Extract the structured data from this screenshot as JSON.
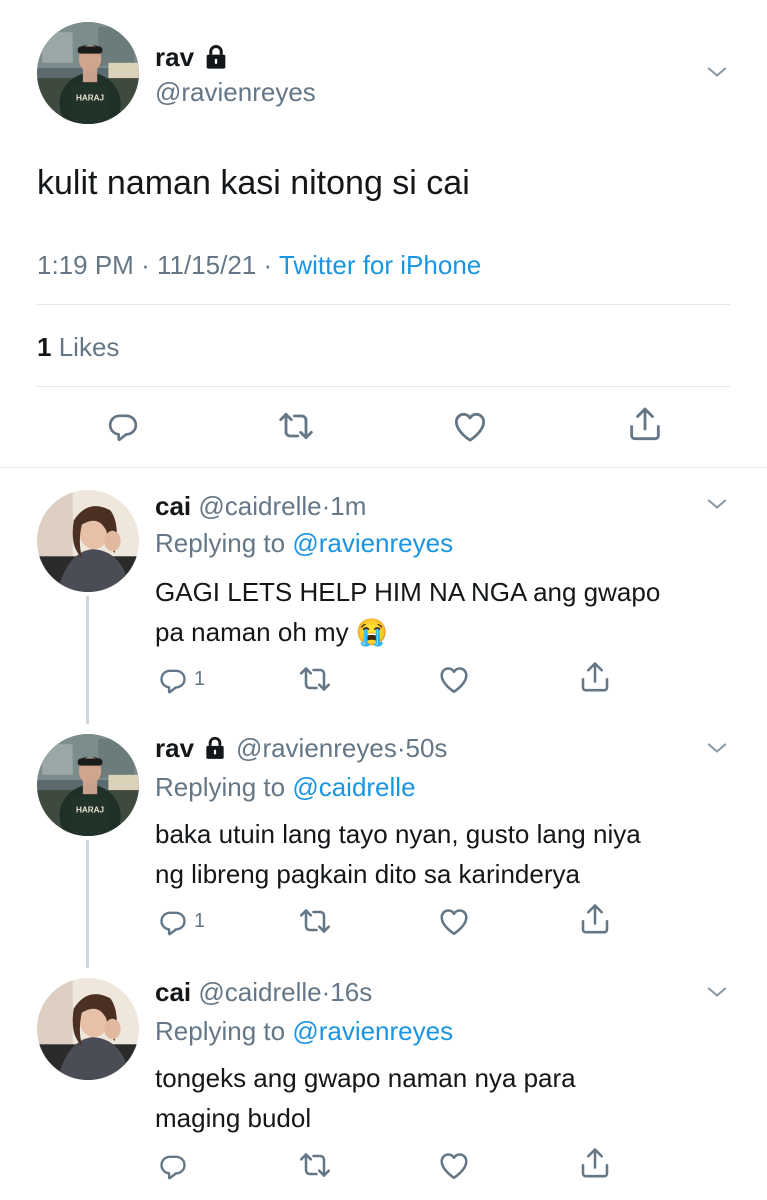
{
  "main_tweet": {
    "display_name": "rav",
    "handle": "@ravienreyes",
    "text": "kulit naman kasi nitong si cai",
    "time": "1:19 PM",
    "date": "11/15/21",
    "sep": "·",
    "client": "Twitter for iPhone",
    "likes_count": "1",
    "likes_label": "Likes"
  },
  "replies": [
    {
      "display_name": "cai",
      "handle": "@caidrelle",
      "time": "1m",
      "replying_prefix": "Replying to",
      "replying_to": "@ravienreyes",
      "text_line1": "GAGI LETS HELP HIM NA NGA ang gwapo",
      "text_line2": "pa naman oh my",
      "emoji": "😭",
      "reply_count": "1"
    },
    {
      "display_name": "rav",
      "handle": "@ravienreyes",
      "time": "50s",
      "replying_prefix": "Replying to",
      "replying_to": "@caidrelle",
      "text_line1": "baka utuin lang tayo nyan, gusto lang niya",
      "text_line2": "ng libreng pagkain dito sa karinderya",
      "reply_count": "1"
    },
    {
      "display_name": "cai",
      "handle": "@caidrelle",
      "time": "16s",
      "replying_prefix": "Replying to",
      "replying_to": "@ravienreyes",
      "text_line1": "tongeks ang gwapo naman nya para",
      "text_line2": "maging budol",
      "reply_count": ""
    }
  ],
  "colors": {
    "text": "#14171a",
    "muted": "#657786",
    "link": "#1b95e0",
    "divider": "#e1e8ed"
  },
  "icons": [
    "lock-icon",
    "chevron-down-icon",
    "reply-icon",
    "retweet-icon",
    "like-icon",
    "share-icon"
  ]
}
